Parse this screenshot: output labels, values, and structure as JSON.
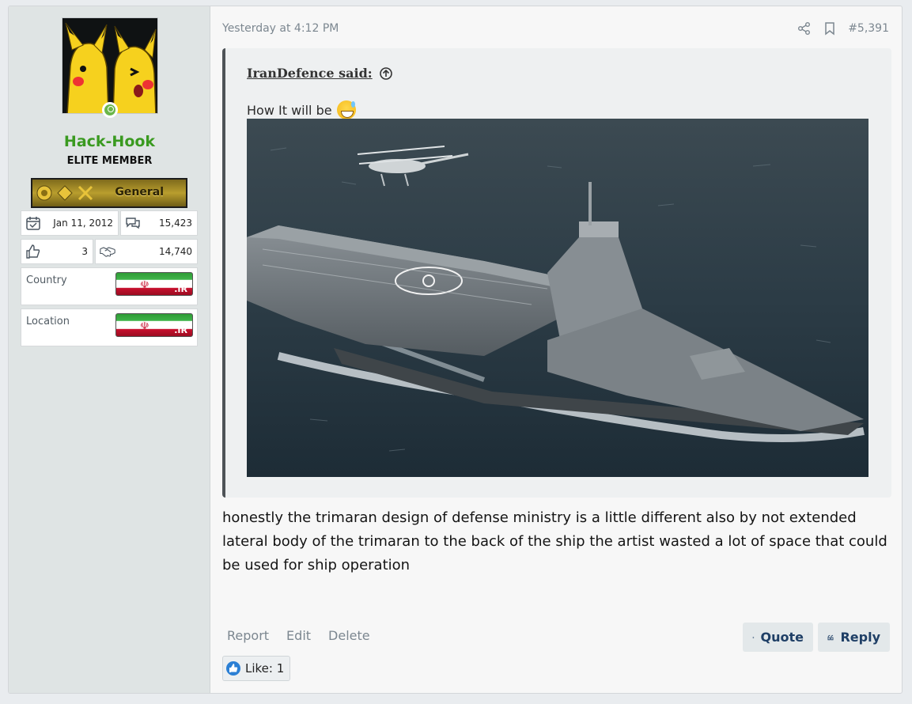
{
  "user": {
    "name": "Hack-Hook",
    "title": "ELITE MEMBER",
    "rank_label": "General",
    "joined": "Jan 11, 2012",
    "messages": "15,423",
    "reactions": "3",
    "trophies": "14,740",
    "country_label": "Country",
    "location_label": "Location",
    "flag_tld": ".IR"
  },
  "post": {
    "timestamp": "Yesterday at 4:12 PM",
    "number": "#5,391",
    "quote": {
      "author": "IranDefence said:",
      "text": "How It will be"
    },
    "message": "honestly the trimaran design of defense ministry is a little different also by not extended lateral body of the trimaran to the back of the ship the artist wasted a lot of space that could be used for ship operation",
    "links": {
      "report": "Report",
      "edit": "Edit",
      "delete": "Delete"
    },
    "buttons": {
      "quote": "Quote",
      "reply": "Reply"
    },
    "likes": "Like: 1"
  },
  "colors": {
    "username": "#3a9a20",
    "button_text": "#1f3f66",
    "like_icon": "#2b7fd4"
  }
}
